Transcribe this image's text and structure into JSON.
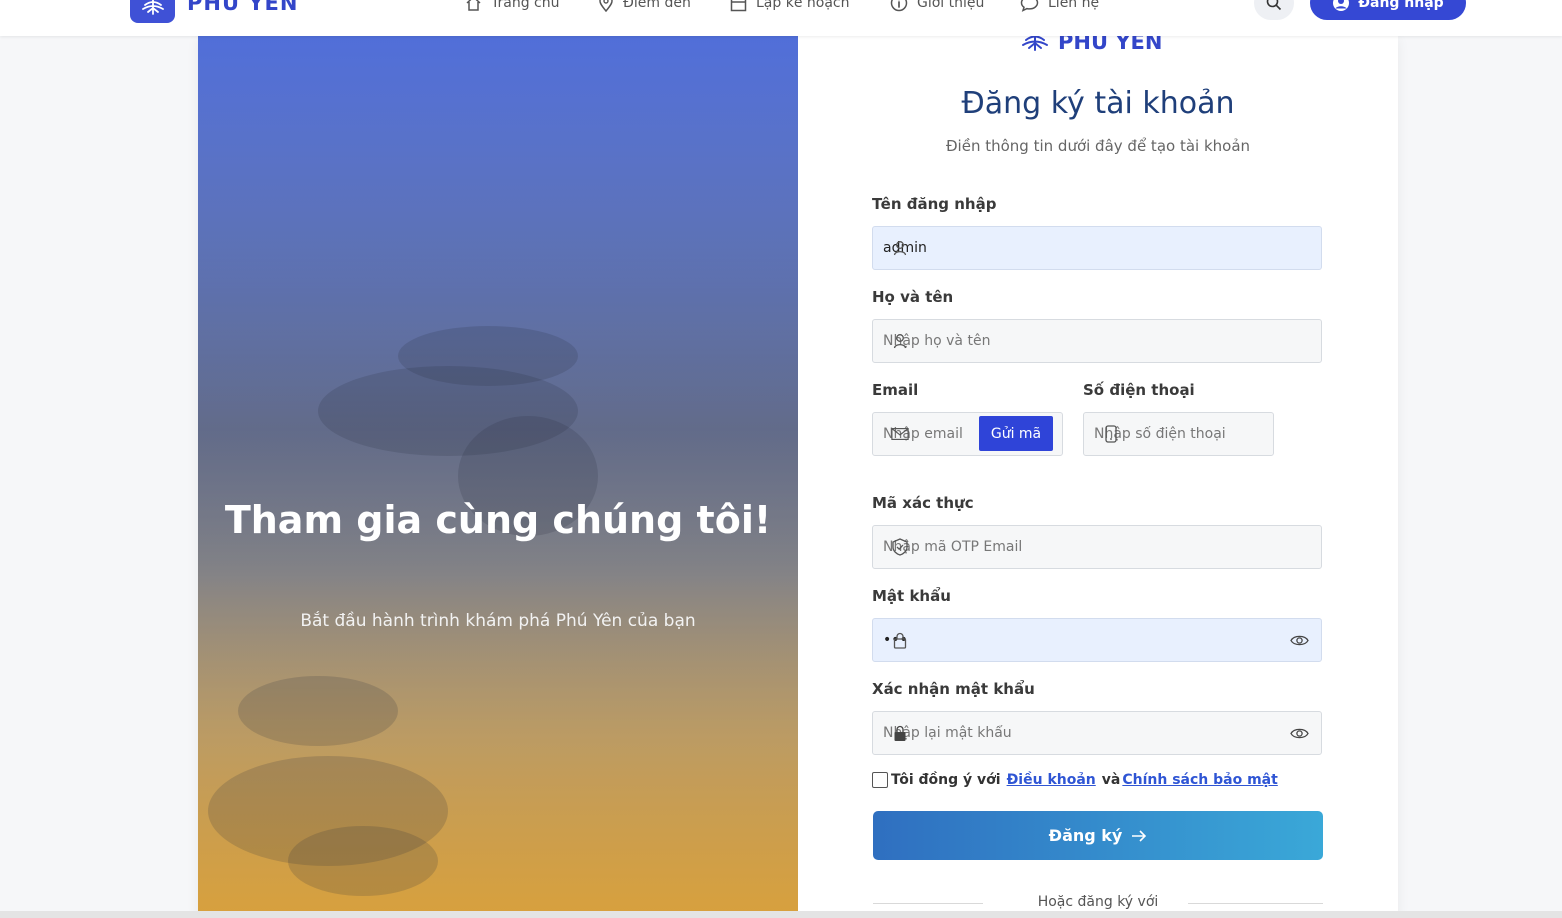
{
  "brand": {
    "name": "PHÚ YÊN",
    "accent": "#3548d4"
  },
  "nav": {
    "items": [
      {
        "label": "Trang chủ",
        "icon": "home-icon"
      },
      {
        "label": "Điểm đến",
        "icon": "map-pin-icon"
      },
      {
        "label": "Lập kế hoạch",
        "icon": "calendar-icon"
      },
      {
        "label": "Giới thiệu",
        "icon": "info-icon"
      },
      {
        "label": "Liên hệ",
        "icon": "chat-icon"
      }
    ],
    "login_label": "Đăng nhập"
  },
  "hero": {
    "title": "Tham gia cùng chúng tôi!",
    "subtitle": "Bắt đầu hành trình khám phá Phú Yên của bạn"
  },
  "form": {
    "logo_text": "PHÚ YÊN",
    "title": "Đăng ký tài khoản",
    "subtitle": "Điền thông tin dưới đây để tạo tài khoản",
    "username": {
      "label": "Tên đăng nhập",
      "value": "admin",
      "placeholder": ""
    },
    "fullname": {
      "label": "Họ và tên",
      "placeholder": "Nhập họ và tên"
    },
    "email": {
      "label": "Email",
      "placeholder": "Nhập email",
      "send_code_label": "Gửi mã"
    },
    "phone": {
      "label": "Số điện thoại",
      "placeholder": "Nhập số điện thoại"
    },
    "otp": {
      "label": "Mã xác thực",
      "placeholder": "Nhập mã OTP Email"
    },
    "password": {
      "label": "Mật khẩu",
      "value": "•••"
    },
    "confirm_password": {
      "label": "Xác nhận mật khẩu",
      "placeholder": "Nhập lại mật khẩu"
    },
    "agree": {
      "prefix": "Tôi đồng ý với",
      "terms": "Điều khoản",
      "and": "và",
      "privacy": "Chính sách bảo mật"
    },
    "register_label": "Đăng ký",
    "divider_text": "Hoặc đăng ký với"
  }
}
